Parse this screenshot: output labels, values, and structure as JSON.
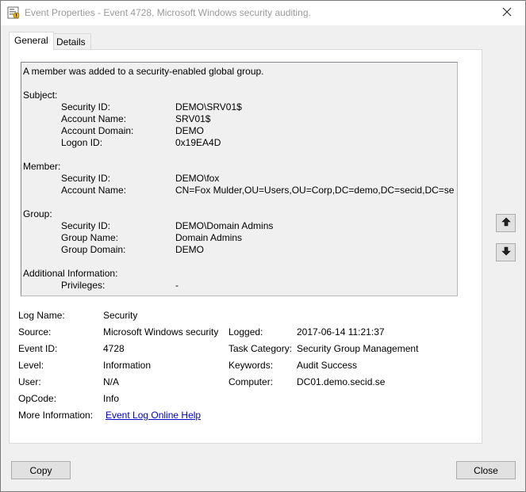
{
  "window": {
    "title": "Event Properties - Event 4728, Microsoft Windows security auditing.",
    "icon": "event-viewer-icon"
  },
  "tabs": [
    {
      "label": "General",
      "active": true
    },
    {
      "label": "Details",
      "active": false
    }
  ],
  "description": {
    "summary": "A member was added to a security-enabled global group.",
    "subject": {
      "heading": "Subject:",
      "rows": [
        {
          "label": "Security ID:",
          "value": "DEMO\\SRV01$"
        },
        {
          "label": "Account Name:",
          "value": "SRV01$"
        },
        {
          "label": "Account Domain:",
          "value": "DEMO"
        },
        {
          "label": "Logon ID:",
          "value": "0x19EA4D"
        }
      ]
    },
    "member": {
      "heading": "Member:",
      "rows": [
        {
          "label": "Security ID:",
          "value": "DEMO\\fox"
        },
        {
          "label": "Account Name:",
          "value": "CN=Fox Mulder,OU=Users,OU=Corp,DC=demo,DC=secid,DC=se"
        }
      ]
    },
    "group": {
      "heading": "Group:",
      "rows": [
        {
          "label": "Security ID:",
          "value": "DEMO\\Domain Admins"
        },
        {
          "label": "Group Name:",
          "value": "Domain Admins"
        },
        {
          "label": "Group Domain:",
          "value": "DEMO"
        }
      ]
    },
    "additional": {
      "heading": "Additional Information:",
      "rows": [
        {
          "label": "Privileges:",
          "value": "-"
        }
      ]
    }
  },
  "fields": {
    "log_name": {
      "label": "Log Name:",
      "value": "Security"
    },
    "source": {
      "label": "Source:",
      "value": "Microsoft Windows security"
    },
    "logged": {
      "label": "Logged:",
      "value": "2017-06-14 11:21:37"
    },
    "event_id": {
      "label": "Event ID:",
      "value": "4728"
    },
    "task_category": {
      "label": "Task Category:",
      "value": "Security Group Management"
    },
    "level": {
      "label": "Level:",
      "value": "Information"
    },
    "keywords": {
      "label": "Keywords:",
      "value": "Audit Success"
    },
    "user": {
      "label": "User:",
      "value": "N/A"
    },
    "computer": {
      "label": "Computer:",
      "value": "DC01.demo.secid.se"
    },
    "opcode": {
      "label": "OpCode:",
      "value": "Info"
    },
    "more_info": {
      "label": "More Information:",
      "link": "Event Log Online Help"
    }
  },
  "buttons": {
    "copy": "Copy",
    "close": "Close",
    "up_icon": "arrow-up-icon",
    "down_icon": "arrow-down-icon"
  }
}
